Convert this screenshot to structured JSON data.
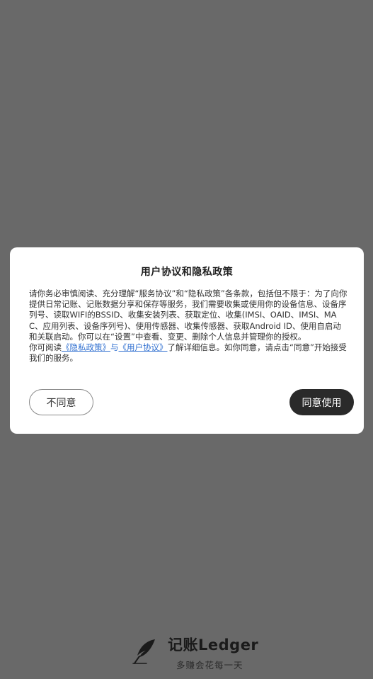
{
  "dialog": {
    "title": "用户协议和隐私政策",
    "body_paragraph_1": "请你务必审慎阅读、充分理解“服务协议”和“隐私政策”各条款，包括但不限于：为了向你提供日常记账、记账数据分享和保存等服务，我们需要收集或使用你的设备信息、设备序列号、读取WIFI的BSSID、收集安装列表、获取定位、收集(IMSI、OAID、IMSI、MAC、应用列表、设备序列号)、使用传感器、收集传感器、获取Android ID、使用自启动和关联启动。你可以在“设置”中查看、变更、删除个人信息并管理你的授权。",
    "body_prefix": "你可阅读",
    "privacy_link": "《隐私政策》",
    "connector": "与",
    "user_agreement_link": "《用户协议》",
    "body_suffix": "了解详细信息。如你同意，请点击“同意”开始接受我们的服务。",
    "disagree_label": "不同意",
    "agree_label": "同意使用"
  },
  "brand": {
    "logo_icon": "quill-feather-icon",
    "name": "记账Ledger",
    "slogan": "多赚会花每一天"
  },
  "colors": {
    "overlay": "#696969",
    "link": "#2f6fd0",
    "primary_button": "#2a2a2a"
  }
}
